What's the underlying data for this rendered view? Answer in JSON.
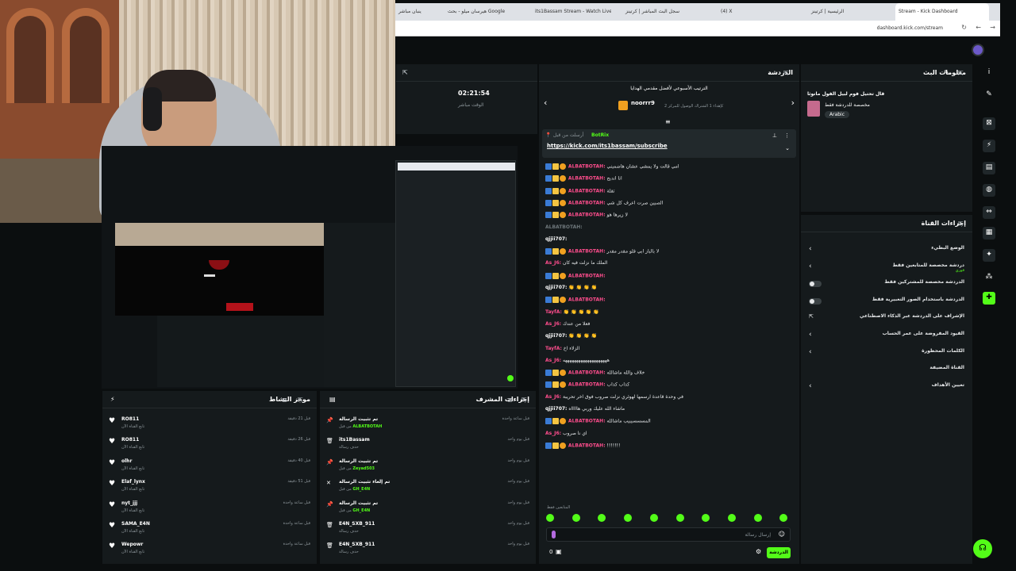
{
  "browser": {
    "tabs": [
      {
        "label": "ينبان مباشر",
        "active": false
      },
      {
        "label": "هيرسان ميلو - بحث Google",
        "active": false
      },
      {
        "label": "its1Bassam Stream - Watch Live",
        "active": false
      },
      {
        "label": "سجل البث المباشر | كرتينز",
        "active": false
      },
      {
        "label": "(4) X",
        "active": false
      },
      {
        "label": "الرئيسية | كرتينز",
        "active": false
      },
      {
        "label": "Stream - Kick Dashboard",
        "active": true
      }
    ],
    "url": "dashboard.kick.com/stream"
  },
  "stats": {
    "uptime": "02:21:54",
    "uptime_label": "الوقت مباشر"
  },
  "chat": {
    "title": "الدردشة",
    "leaderboard_title": "الترتيب الأسبوعي لأفضل مقدمي الهدايا",
    "leader_name": "noorrr9",
    "leader_sub": "كإهداء 1 الشتراك الوصول للمركز 2",
    "pinned_by": "أرسلت من قبل",
    "pinned_user": "BotRix",
    "pinned_link": "https://kick.com/its1bassam/subscribe",
    "messages": [
      {
        "user": "ALBATBOTAH",
        "text": "امي قالت ولا يمشي عشان هاضميني",
        "badges": true,
        "color": "pink"
      },
      {
        "user": "ALBATBOTAH",
        "text": "انا اندبح",
        "badges": true,
        "color": "pink"
      },
      {
        "user": "ALBATBOTAH",
        "text": "تقلة",
        "badges": true,
        "color": "pink"
      },
      {
        "user": "ALBATBOTAH",
        "text": "الصبين صرت اعرف كل شي",
        "badges": true,
        "color": "pink"
      },
      {
        "user": "ALBATBOTAH",
        "text": "لا زيرها هو",
        "badges": true,
        "color": "pink"
      },
      {
        "user": "ALBATBOTAH",
        "text": "",
        "badges": false,
        "color": "muted"
      },
      {
        "user": "qjjii707",
        "text": "",
        "badges": false,
        "color": "white"
      },
      {
        "user": "ALBATBOTAH",
        "text": "لا بالباز ابي فلو مقدر مقدر",
        "badges": true,
        "color": "pink"
      },
      {
        "user": "As_J6",
        "text": "الملك ما نزلت فيه كان",
        "badges": false,
        "color": "pink"
      },
      {
        "user": "ALBATBOTAH",
        "text": "",
        "badges": true,
        "color": "pink"
      },
      {
        "user": "qjjii707",
        "text": "👏 👏 👏 👏",
        "badges": false,
        "color": "white"
      },
      {
        "user": "ALBATBOTAH",
        "text": "",
        "badges": true,
        "color": "pink"
      },
      {
        "user": "TayfA",
        "text": "👏 👏 👏 👏 👏",
        "badges": false,
        "color": "pink"
      },
      {
        "user": "As_J6",
        "text": "فعلا من عندك",
        "badges": false,
        "color": "pink"
      },
      {
        "user": "qjjii707",
        "text": "👏 👏 👏 👏",
        "badges": false,
        "color": "white"
      },
      {
        "user": "TayfA",
        "text": "الزلاء اخ",
        "badges": false,
        "color": "pink"
      },
      {
        "user": "As_J6",
        "text": "ههههههههههههههههههههه",
        "badges": false,
        "color": "pink"
      },
      {
        "user": "ALBATBOTAH",
        "text": "خلاف والله ماشالله",
        "badges": true,
        "color": "pink"
      },
      {
        "user": "ALBATBOTAH",
        "text": "كذاب كذاب",
        "badges": true,
        "color": "pink"
      },
      {
        "user": "As_J6",
        "text": "في وحدة قاعدة ارسمها لهوئري نزلت صروب فوق آخر تحريبة",
        "badges": false,
        "color": "pink"
      },
      {
        "user": "qjjii707",
        "text": "ماشاء الله عليك وربي هاااااه",
        "badges": false,
        "color": "white"
      },
      {
        "user": "ALBATBOTAH",
        "text": "المسسسيبيب ماشالله",
        "badges": true,
        "color": "pink"
      },
      {
        "user": "As_J6",
        "text": "اي نا صروب",
        "badges": false,
        "color": "pink"
      },
      {
        "user": "ALBATBOTAH",
        "text": "!!!!!!!",
        "badges": true,
        "color": "pink"
      }
    ],
    "followers_only": "المتابعين فقط",
    "input_placeholder": "إرسال رسالة",
    "send_label": "الدردشة",
    "viewer_count": "0"
  },
  "stream_info": {
    "title": "معلومات البث",
    "stream_title": "قال تحتيل فوم لبيل الفول مانوثا",
    "category": "مخصصة للدردشة فقط",
    "language": "Arabic"
  },
  "channel_actions": {
    "title": "إجراءات القناة",
    "items": [
      {
        "label": "الوضع البطيء",
        "kind": "chevron",
        "sub": ""
      },
      {
        "label": "دردشة مخصصة للمتابعين فقط",
        "kind": "chevron",
        "sub": "فوري"
      },
      {
        "label": "الدردشة مخصصة للمشتركين فقط",
        "kind": "toggle",
        "sub": ""
      },
      {
        "label": "الدردشة باستخدام الصور التعبيرية فقط",
        "kind": "toggle",
        "sub": ""
      },
      {
        "label": "الإشراف على الدردشة عبر الذكاء الاصطناعي",
        "kind": "external",
        "sub": ""
      },
      {
        "label": "القيود المفروضة على عمر الحساب",
        "kind": "chevron",
        "sub": ""
      },
      {
        "label": "الكلمات المحظورة",
        "kind": "chevron",
        "sub": ""
      },
      {
        "label": "القناة المضيفة",
        "kind": "none",
        "sub": ""
      },
      {
        "label": "تعيين الأهداف",
        "kind": "chevron",
        "sub": ""
      }
    ]
  },
  "activity": {
    "title": "موجز النشاط",
    "items": [
      {
        "name": "RO811",
        "sub": "تابع القناة الآن",
        "time": "قبل 21 دقيقة"
      },
      {
        "name": "RO811",
        "sub": "تابع القناة الآن",
        "time": "قبل 26 دقيقة"
      },
      {
        "name": "olhr",
        "sub": "تابع القناة الآن",
        "time": "قبل 40 دقيقة"
      },
      {
        "name": "Elaf_lynx",
        "sub": "تابع القناة الآن",
        "time": "قبل 51 دقيقة"
      },
      {
        "name": "nyt_jjj",
        "sub": "تابع القناة الآن",
        "time": "قبل ساعة واحدة"
      },
      {
        "name": "SAMA_E4N",
        "sub": "تابع القناة الآن",
        "time": "قبل ساعة واحدة"
      },
      {
        "name": "Wepowr",
        "sub": "تابع القناة الآن",
        "time": "قبل ساعة واحدة"
      }
    ]
  },
  "mod_log": {
    "title": "إجراءات المشرف",
    "items": [
      {
        "name": "تم تثبيت الرسالة",
        "sub": "من قبل",
        "user": "ALBATBOTAH",
        "time": "قبل ساعة واحدة",
        "icon": "pin"
      },
      {
        "name": "its1Bassam",
        "sub": "حذف رسالة",
        "user": "",
        "time": "قبل يوم واحد",
        "icon": "trash"
      },
      {
        "name": "تم تثبيت الرسالة",
        "sub": "من قبل",
        "user": "Zeyad503",
        "time": "قبل يوم واحد",
        "icon": "pin"
      },
      {
        "name": "تم إلغاء تثبيت الرسالة",
        "sub": "من قبل",
        "user": "GH_E4N",
        "time": "قبل يوم واحد",
        "icon": "unpin"
      },
      {
        "name": "تم تثبيت الرسالة",
        "sub": "من قبل",
        "user": "GH_E4N",
        "time": "قبل يوم واحد",
        "icon": "pin"
      },
      {
        "name": "E4N_SXB_911",
        "sub": "حذف رسالة",
        "user": "",
        "time": "قبل يوم واحد",
        "icon": "trash"
      },
      {
        "name": "E4N_SXB_911",
        "sub": "حذف رسالة",
        "user": "",
        "time": "قبل يوم واحد",
        "icon": "trash"
      }
    ]
  },
  "colors": {
    "accent": "#53fc18",
    "pink": "#ff4d8d",
    "panel": "#151a1c"
  }
}
